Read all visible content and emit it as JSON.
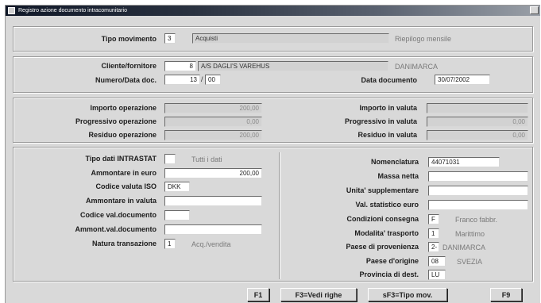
{
  "window": {
    "title": "Registro azione documento intracomunitario"
  },
  "movement": {
    "label": "Tipo movimento",
    "code": "3",
    "description": "Acquisti",
    "note": "Riepilogo mensile"
  },
  "party": {
    "client_label": "Cliente/fornitore",
    "client_code": "8",
    "client_name": "A/S DAGLI'S VAREHUS",
    "country": "DANIMARCA",
    "num_label": "Numero/Data doc.",
    "doc_number": "13",
    "doc_suffix": "00",
    "date_label": "Data documento",
    "doc_date": "30/07/2002"
  },
  "amounts": {
    "importo_label": "Importo operazione",
    "importo_value": "200,00",
    "progressivo_label": "Progressivo operazione",
    "progressivo_value": "0,00",
    "residuo_label": "Residuo operazione",
    "residuo_value": "200,00",
    "importo_valuta_label": "Importo in valuta",
    "importo_valuta_value": "",
    "progressivo_valuta_label": "Progressivo in valuta",
    "progressivo_valuta_value": "0,00",
    "residuo_valuta_label": "Residuo in valuta",
    "residuo_valuta_value": "0,00"
  },
  "intrastat": {
    "tipo_label": "Tipo dati INTRASTAT",
    "tipo_code": "",
    "tipo_desc": "Tutti i dati",
    "ammontare_euro_label": "Ammontare in euro",
    "ammontare_euro_value": "200,00",
    "codice_valuta_label": "Codice valuta ISO",
    "codice_valuta_value": "DKK",
    "ammontare_valuta_label": "Ammontare in valuta",
    "ammontare_valuta_value": "",
    "codice_val_doc_label": "Codice val.documento",
    "codice_val_doc_value": "",
    "ammont_val_doc_label": "Ammont.val.documento",
    "ammont_val_doc_value": "",
    "natura_label": "Natura transazione",
    "natura_code": "1",
    "natura_desc": "Acq./vendita"
  },
  "goods": {
    "nomenclatura_label": "Nomenclatura",
    "nomenclatura_value": "44071031",
    "massa_label": "Massa netta",
    "massa_value": "",
    "unita_label": "Unita' supplementare",
    "unita_value": "",
    "val_stat_label": "Val. statistico euro",
    "val_stat_value": "",
    "condizioni_label": "Condizioni consegna",
    "condizioni_code": "F",
    "condizioni_desc": "Franco fabbr.",
    "modalita_label": "Modalita' trasporto",
    "modalita_code": "1",
    "modalita_desc": "Marittimo",
    "provenienza_label": "Paese di provenienza",
    "provenienza_code": "2-",
    "provenienza_desc": "DANIMARCA",
    "origine_label": "Paese d'origine",
    "origine_code": "08",
    "origine_desc": "SVEZIA",
    "provincia_label": "Provincia di dest.",
    "provincia_value": "LU"
  },
  "buttons": {
    "f1": "F1",
    "f3": "F3=Vedi righe",
    "sf3": "sF3=Tipo mov.",
    "f9": "F9"
  }
}
